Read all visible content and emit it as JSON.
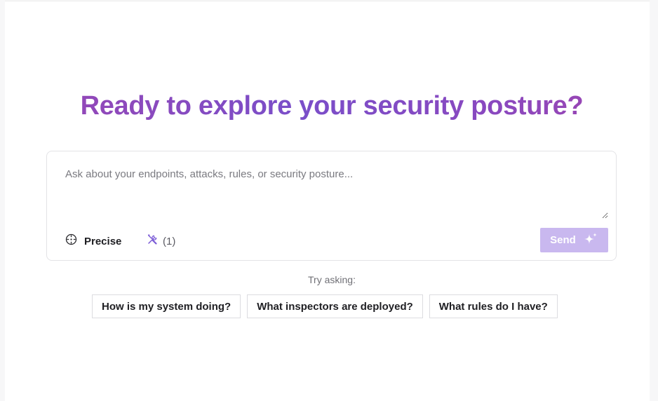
{
  "hero": {
    "title": "Ready to explore your security posture?"
  },
  "composer": {
    "placeholder": "Ask about your endpoints, attacks, rules, or security posture...",
    "value": "",
    "mode_label": "Precise",
    "mode_icon": "target-icon",
    "tools_icon": "tools-icon",
    "tools_count": "(1)",
    "send_label": "Send",
    "send_icon": "sparkles-icon",
    "send_color": "#c9b8ef"
  },
  "suggestions": {
    "label": "Try asking:",
    "items": [
      "How is my system doing?",
      "What inspectors are deployed?",
      "What rules do I have?"
    ]
  },
  "colors": {
    "title_gradient_start": "#9a46b3",
    "title_gradient_mid": "#7a4ec9",
    "accent_icon": "#7b5cd6"
  }
}
